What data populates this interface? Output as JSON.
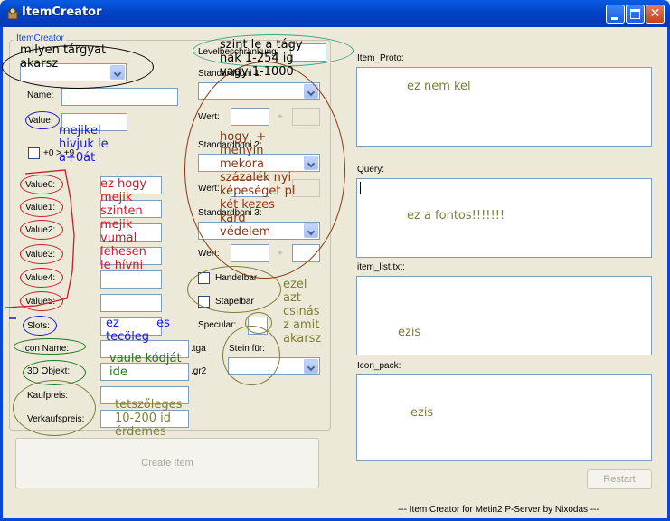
{
  "window": {
    "title": "ItemCreator",
    "colors": {
      "titlebar": "#0a5be0",
      "background": "#ece9d8"
    },
    "icons": {
      "app": "item-creator-app-icon",
      "minimize": "minimize-icon",
      "maximize": "maximize-icon",
      "close": "close-icon"
    }
  },
  "group": {
    "legend": "ItemCreator"
  },
  "left": {
    "name_label": "Name:",
    "value_label": "Value:",
    "plus_check_label": "+0 > +9",
    "value_labels": [
      "Value0:",
      "Value1:",
      "Value2:",
      "Value3:",
      "Value4:",
      "Value5:"
    ],
    "slots_label": "Slots:",
    "icon_name_label": "Icon Name:",
    "icon_ext": ".tga",
    "obj_label": "3D Objekt:",
    "obj_ext": ".gr2",
    "kauf_label": "Kaufpreis:",
    "verkauf_label": "Verkaufspreis:"
  },
  "mid": {
    "level_label": "Levelbeschränkung:",
    "bonus1_label": "Standardboni 1:",
    "wert_label": "Wert:",
    "plus": "+",
    "bonus2_label": "Standardboni 2:",
    "bonus3_label": "Standardboni 3:",
    "handelbar_label": "Handelbar",
    "stapelbar_label": "Stapelbar",
    "specular_label": "Specular:",
    "stein_label": "Stein für:"
  },
  "right": {
    "proto_label": "Item_Proto:",
    "query_label": "Query:",
    "list_label": "item_list.txt:",
    "icon_pack_label": "Icon_pack:"
  },
  "buttons": {
    "create": "Create Item",
    "restart": "Restart"
  },
  "footer": "--- Item Creator for Metin2 P-Server by Nixodas ---",
  "annotations": {
    "type": "milyen tárgyat\nakarsz",
    "level": "szint le a tágy\nnak 1-254 ig\nvagy 1-1000",
    "proto": "ez nem kel",
    "value": "mejikel\nhivjuk le\na+0át",
    "bonus": "hogy  +\nmenyin\nmekora\nszázalék nyi\nképeséget pl\nkét kezes\nkard\nvédelem",
    "values": "ez hogy\nmejik\nszinten\nmejik\nvumal\nlehesen\nle hívni",
    "query": "ez a fontos!!!!!!!",
    "flags": "ezel\nazt\ncsinás\nz amit\nakarsz",
    "slots": "ez          es\ntecöleg",
    "vnum": "vaule kódját\nide",
    "list": "ezis",
    "price": "tetszőleges\n10-200 id\nérdemes",
    "icon_pack": "ezis"
  }
}
